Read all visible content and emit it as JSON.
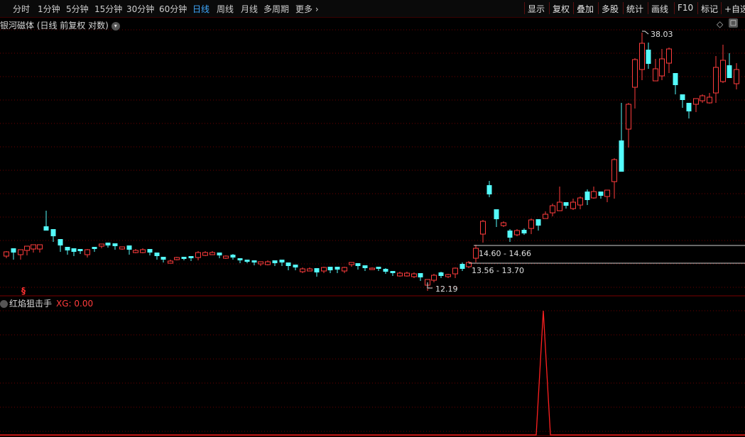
{
  "toolbar": {
    "periods": [
      {
        "label": "分时",
        "active": false
      },
      {
        "label": "1分钟",
        "active": false
      },
      {
        "label": "5分钟",
        "active": false
      },
      {
        "label": "15分钟",
        "active": false
      },
      {
        "label": "30分钟",
        "active": false
      },
      {
        "label": "60分钟",
        "active": false
      },
      {
        "label": "日线",
        "active": true
      },
      {
        "label": "周线",
        "active": false
      },
      {
        "label": "月线",
        "active": false
      },
      {
        "label": "多周期",
        "active": false
      },
      {
        "label": "更多",
        "active": false
      }
    ],
    "more_chevron": "›",
    "tools": [
      "显示",
      "复权",
      "叠加",
      "多股",
      "统计",
      "画线",
      "F10",
      "标记",
      "+自选"
    ]
  },
  "main_panel": {
    "title": "银河磁体 (日线 前复权 对数)",
    "title_icon": "chevron-down-icon",
    "high_label": "38.03",
    "low_label": "12.19",
    "zone_upper_label": "14.60 - 14.66",
    "zone_lower_label": "13.56 - 13.70",
    "signal_mark": "§"
  },
  "indicator_panel": {
    "name": "红焰狙击手",
    "value_text": "XG: 0.00"
  },
  "colors": {
    "up": "#ff3c3c",
    "down": "#54fcfc",
    "grid": "#6e0000",
    "signal": "#ff2020",
    "active_tab": "#3fa9ff"
  },
  "chart_data": {
    "type": "candlestick",
    "price_scale": "log",
    "high": 38.03,
    "low": 12.19,
    "zones": [
      [
        14.6,
        14.66
      ],
      [
        13.56,
        13.7
      ]
    ],
    "indicator": {
      "name": "XG",
      "value": 0.0,
      "signal_index": 85
    }
  }
}
